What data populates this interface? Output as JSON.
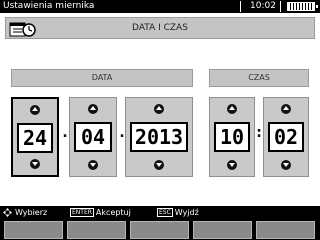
{
  "window": {
    "title": "Ustawienia miernika",
    "time": "10:02"
  },
  "header": {
    "title": "DATA I CZAS",
    "icon": "clock-calendar-icon"
  },
  "sections": {
    "date_label": "DATA",
    "time_label": "CZAS"
  },
  "fields": {
    "day": "24",
    "month": "04",
    "year": "2013",
    "hour": "10",
    "minute": "02"
  },
  "separators": {
    "date": ".",
    "time": ":"
  },
  "statusbar": {
    "nav_label": "Wybierz",
    "enter_key": "ENTER",
    "enter_label": "Akceptuj",
    "esc_key": "ESC",
    "esc_label": "Wyjdź"
  }
}
